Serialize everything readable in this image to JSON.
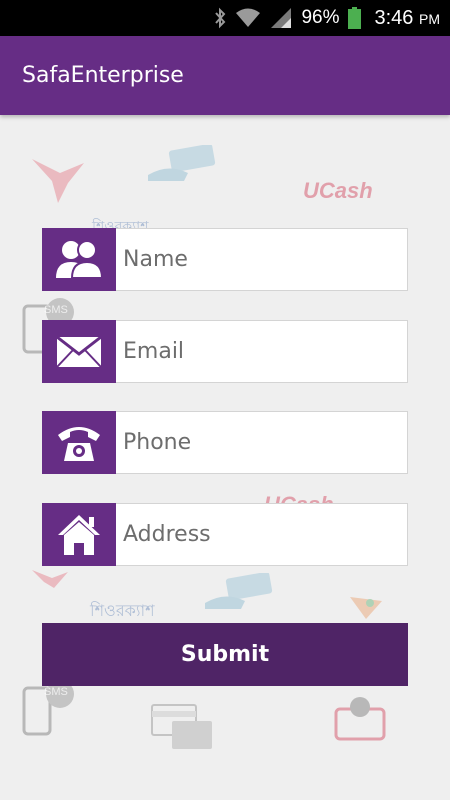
{
  "status_bar": {
    "battery_percent": "96%",
    "time": "3:46",
    "ampm": "PM",
    "icons": [
      "bluetooth-icon",
      "wifi-icon",
      "signal-icon",
      "battery-icon"
    ]
  },
  "app_bar": {
    "title": "SafaEnterprise"
  },
  "form": {
    "fields": [
      {
        "icon": "people-icon",
        "placeholder": "Name"
      },
      {
        "icon": "envelope-icon",
        "placeholder": "Email"
      },
      {
        "icon": "telephone-icon",
        "placeholder": "Phone"
      },
      {
        "icon": "home-icon",
        "placeholder": "Address"
      }
    ],
    "submit_label": "Submit"
  },
  "background": {
    "watermark_texts": [
      "UCash",
      "UCash",
      "শিওরক্যাশ",
      "শিওরক্যাশ",
      "SMS",
      "SMS"
    ]
  },
  "colors": {
    "primary": "#662d85",
    "submit": "#4f2466",
    "background": "#efefef",
    "accent_red": "#c8102e"
  }
}
